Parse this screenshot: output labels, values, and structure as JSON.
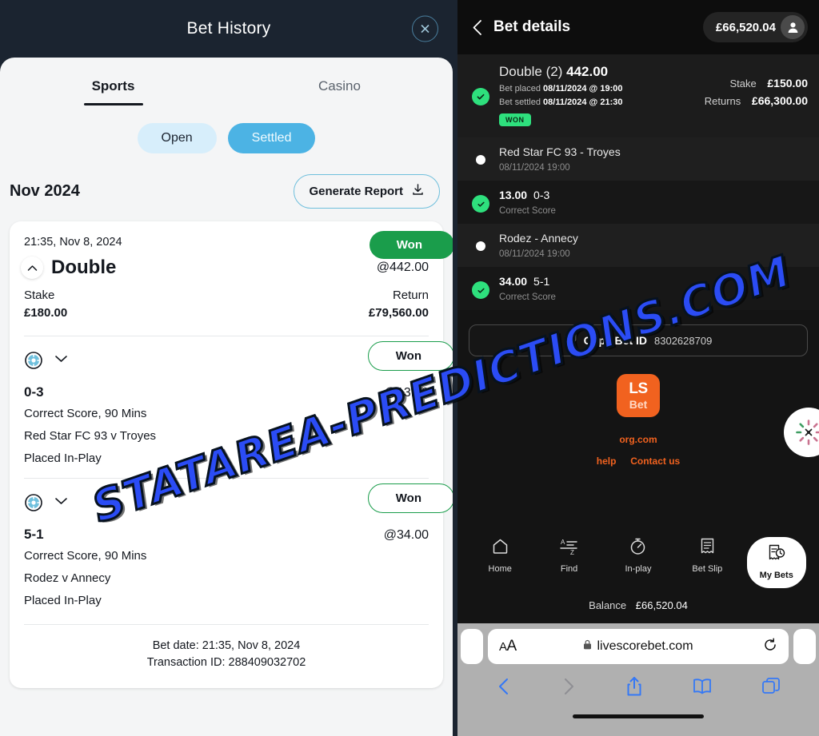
{
  "left": {
    "header": {
      "title": "Bet History",
      "close_icon": "close-circle-icon"
    },
    "tabs": [
      {
        "label": "Sports",
        "active": true
      },
      {
        "label": "Casino",
        "active": false
      }
    ],
    "filters": [
      {
        "label": "Open",
        "selected": false
      },
      {
        "label": "Settled",
        "selected": true
      }
    ],
    "month_label": "Nov 2024",
    "generate_report": {
      "label": "Generate Report",
      "icon": "download-icon"
    },
    "bet_card": {
      "placed_datetime": "21:35, Nov 8, 2024",
      "status": "Won",
      "title": "Double",
      "odds": "@442.00",
      "stake_label": "Stake",
      "stake_value": "£180.00",
      "return_label": "Return",
      "return_value": "£79,560.00",
      "legs": [
        {
          "status": "Won",
          "score": "0-3",
          "odds": "@13.00",
          "market": "Correct Score, 90 Mins",
          "fixture": "Red Star FC 93 v Troyes",
          "note": "Placed In-Play",
          "sport_icon": "football-icon",
          "expand_icon": "chevron-down-icon"
        },
        {
          "status": "Won",
          "score": "5-1",
          "odds": "@34.00",
          "market": "Correct Score, 90 Mins",
          "fixture": "Rodez v Annecy",
          "note": "Placed In-Play",
          "sport_icon": "football-icon",
          "expand_icon": "chevron-down-icon"
        }
      ],
      "footer_bet_date": "Bet date: 21:35, Nov 8, 2024",
      "footer_transaction_id": "Transaction ID: 288409032702"
    }
  },
  "watermark": {
    "text": "STATAREA-PREDICTIONS.COM"
  },
  "right": {
    "header": {
      "back_icon": "chevron-left-icon",
      "title": "Bet details",
      "balance": "£66,520.04",
      "avatar_icon": "person-icon"
    },
    "summary": {
      "title_prefix": "Double (2)",
      "title_odds": "442.00",
      "placed_label": "Bet placed",
      "placed_value": "08/11/2024 @ 19:00",
      "settled_label": "Bet settled",
      "settled_value": "08/11/2024 @ 21:30",
      "status_chip": "WON",
      "stake_label": "Stake",
      "stake_value": "£150.00",
      "returns_label": "Returns",
      "returns_value": "£66,300.00"
    },
    "timeline": [
      {
        "type": "event",
        "title": "Red Star FC 93 - Troyes",
        "sub": "08/11/2024 19:00"
      },
      {
        "type": "selection",
        "odds": "13.00",
        "score": "0-3",
        "market": "Correct Score"
      },
      {
        "type": "event",
        "title": "Rodez - Annecy",
        "sub": "08/11/2024 19:00"
      },
      {
        "type": "selection",
        "odds": "34.00",
        "score": "5-1",
        "market": "Correct Score"
      }
    ],
    "copy_bet": {
      "icon": "copy-icon",
      "label": "Copy Bet ID",
      "value": "8302628709"
    },
    "brand": {
      "line1": "LS",
      "line2": "Bet"
    },
    "footer_links": [
      "org.com",
      "help",
      "Contact us"
    ],
    "bottom_nav": [
      {
        "label": "Home",
        "icon": "home-icon",
        "active": false
      },
      {
        "label": "Find",
        "icon": "az-list-icon",
        "active": false
      },
      {
        "label": "In-play",
        "icon": "stopwatch-icon",
        "active": false
      },
      {
        "label": "Bet Slip",
        "icon": "receipt-icon",
        "active": false
      },
      {
        "label": "My Bets",
        "icon": "bet-receipt-clock-icon",
        "active": true
      }
    ],
    "nav_balance_label": "Balance",
    "nav_balance_value": "£66,520.04"
  },
  "safari": {
    "text_size_label": "AA",
    "lock_icon": "lock-icon",
    "url": "livescorebet.com",
    "reload_icon": "reload-icon",
    "tools": [
      {
        "icon": "back-arrow-icon",
        "enabled": true
      },
      {
        "icon": "forward-arrow-icon",
        "enabled": false
      },
      {
        "icon": "share-icon",
        "enabled": true
      },
      {
        "icon": "bookmarks-icon",
        "enabled": true
      },
      {
        "icon": "tabs-icon",
        "enabled": true
      }
    ]
  },
  "colors": {
    "dark_header": "#1b2430",
    "sheet_bg": "#f4f5f6",
    "accent_blue": "#4cb3e4",
    "won_green": "#1a9d4b",
    "chip_green": "#2ee07d",
    "brand_orange": "#f1621f",
    "watermark_blue": "#2b4cf5"
  }
}
